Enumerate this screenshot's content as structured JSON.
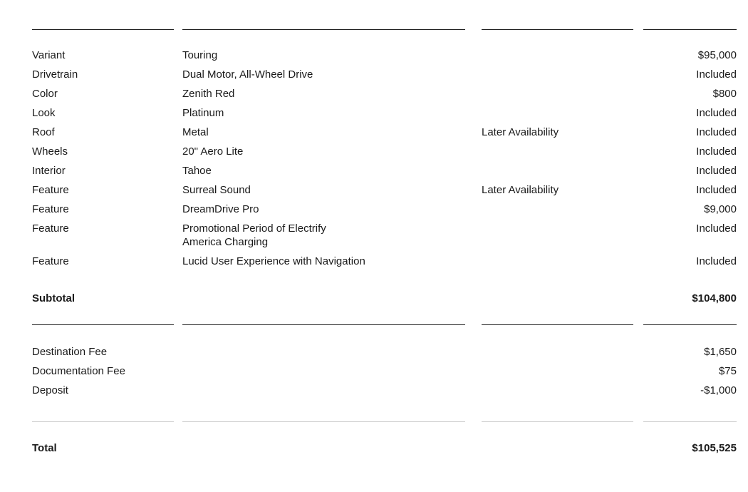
{
  "order_summary": {
    "line_items": [
      {
        "label": "Variant",
        "description": "Touring",
        "note": "",
        "price": "$95,000"
      },
      {
        "label": "Drivetrain",
        "description": "Dual Motor, All-Wheel Drive",
        "note": "",
        "price": "Included"
      },
      {
        "label": "Color",
        "description": "Zenith Red",
        "note": "",
        "price": "$800"
      },
      {
        "label": "Look",
        "description": "Platinum",
        "note": "",
        "price": "Included"
      },
      {
        "label": "Roof",
        "description": "Metal",
        "note": "Later Availability",
        "price": "Included"
      },
      {
        "label": "Wheels",
        "description": "20\" Aero Lite",
        "note": "",
        "price": "Included"
      },
      {
        "label": "Interior",
        "description": "Tahoe",
        "note": "",
        "price": "Included"
      },
      {
        "label": "Feature",
        "description": "Surreal Sound",
        "note": "Later Availability",
        "price": "Included"
      },
      {
        "label": "Feature",
        "description": "DreamDrive Pro",
        "note": "",
        "price": "$9,000"
      },
      {
        "label": "Feature",
        "description_line1": "Promotional Period of Electrify",
        "description_line2": "America Charging",
        "note": "",
        "price": "Included"
      },
      {
        "label": "Feature",
        "description": "Lucid User Experience with Navigation",
        "note": "",
        "price": "Included"
      }
    ],
    "subtotal": {
      "label": "Subtotal",
      "price": "$104,800"
    },
    "fees": [
      {
        "label": "Destination Fee",
        "price": "$1,650"
      },
      {
        "label": "Documentation Fee",
        "price": "$75"
      },
      {
        "label": "Deposit",
        "price": "-$1,000"
      }
    ],
    "total": {
      "label": "Total",
      "price": "$105,525"
    }
  }
}
